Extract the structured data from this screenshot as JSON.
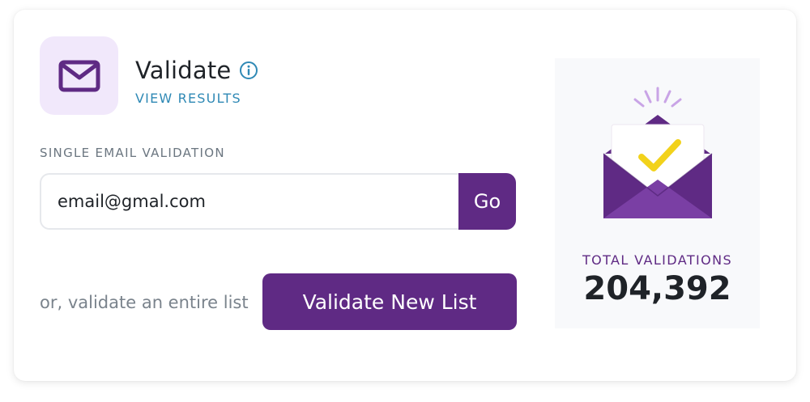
{
  "header": {
    "title": "Validate",
    "view_results": "VIEW RESULTS",
    "icons": {
      "tile": "envelope-icon",
      "info": "info-icon"
    }
  },
  "single": {
    "label": "SINGLE EMAIL VALIDATION",
    "email_value": "email@gmal.com",
    "go_label": "Go"
  },
  "list": {
    "or_text": "or, validate an entire list",
    "button_label": "Validate New List"
  },
  "stats": {
    "label": "TOTAL VALIDATIONS",
    "value": "204,392",
    "illustration": "envelope-check-illustration"
  },
  "colors": {
    "brand_purple": "#5f2a84",
    "tile_bg": "#f1e8fb",
    "link_blue": "#2f89b5",
    "check_yellow": "#f2d21b"
  }
}
